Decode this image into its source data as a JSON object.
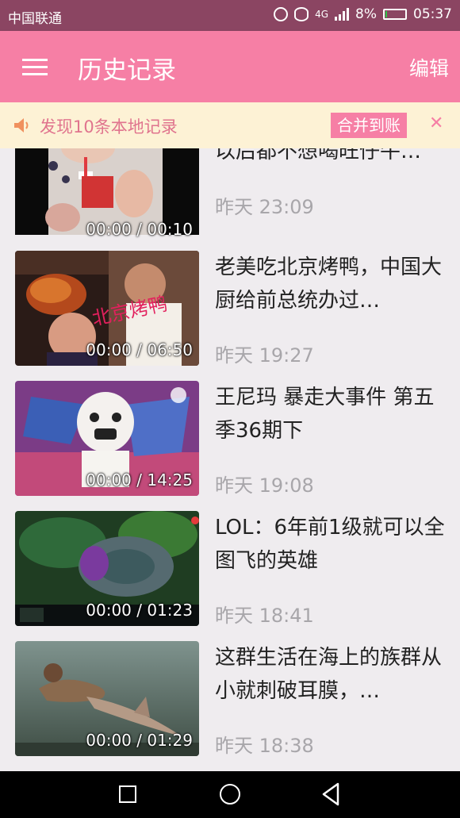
{
  "status_bar": {
    "carrier": "中国联通",
    "network": "4G",
    "battery": "8%",
    "battery_level": 0.08,
    "time": "05:37"
  },
  "app_bar": {
    "title": "历史记录",
    "edit_label": "编辑",
    "menu_icon": "hamburger-menu-icon"
  },
  "notice": {
    "icon": "speaker-icon",
    "text": "发现10条本地记录",
    "merge_label": "合并到账",
    "close_glyph": "✕"
  },
  "history": {
    "items": [
      {
        "title": "以后都不想喝旺仔牛…",
        "duration": "00:00 / 00:10",
        "time": "昨天 23:09"
      },
      {
        "title": "老美吃北京烤鸭，中国大厨给前总统办过…",
        "duration": "00:00 / 06:50",
        "time": "昨天 19:27"
      },
      {
        "title": "王尼玛 暴走大事件 第五季36期下",
        "duration": "00:00 / 14:25",
        "time": "昨天 19:08"
      },
      {
        "title": "LOL：6年前1级就可以全图飞的英雄",
        "duration": "00:00 / 01:23",
        "time": "昨天 18:41"
      },
      {
        "title": "这群生活在海上的族群从小就刺破耳膜，…",
        "duration": "00:00 / 01:29",
        "time": "昨天 18:38"
      }
    ]
  },
  "nav_bar": {
    "recent_icon": "square-recent-apps-icon",
    "home_icon": "circle-home-icon",
    "back_icon": "triangle-back-icon"
  },
  "colors": {
    "status_bar": "#8b4562",
    "accent": "#f67fa5",
    "notice_bg": "#fdf2d5",
    "notice_text": "#e0748e",
    "list_bg": "#efecef"
  }
}
